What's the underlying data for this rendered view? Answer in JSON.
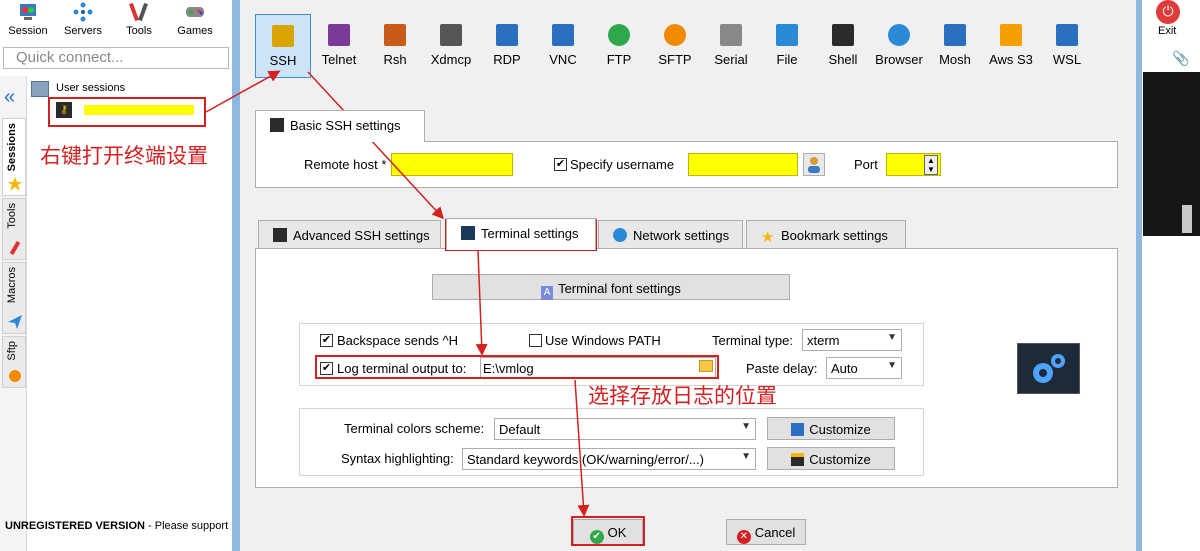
{
  "toolbar": {
    "session": "Session",
    "servers": "Servers",
    "tools": "Tools",
    "games": "Games",
    "exit": "Exit"
  },
  "quick_connect": {
    "placeholder": "Quick connect..."
  },
  "side_tabs": [
    "Sessions",
    "Tools",
    "Macros",
    "Sftp"
  ],
  "tree": {
    "root": "User sessions"
  },
  "status_bar": {
    "version": "UNREGISTERED VERSION",
    "message": "  -  Please support M"
  },
  "session_types": [
    {
      "label": "SSH",
      "icon": "key-icon"
    },
    {
      "label": "Telnet",
      "icon": "telnet-icon"
    },
    {
      "label": "Rsh",
      "icon": "rsh-icon"
    },
    {
      "label": "Xdmcp",
      "icon": "xdmcp-icon"
    },
    {
      "label": "RDP",
      "icon": "rdp-icon"
    },
    {
      "label": "VNC",
      "icon": "vnc-icon"
    },
    {
      "label": "FTP",
      "icon": "ftp-icon"
    },
    {
      "label": "SFTP",
      "icon": "sftp-icon"
    },
    {
      "label": "Serial",
      "icon": "serial-icon"
    },
    {
      "label": "File",
      "icon": "file-icon"
    },
    {
      "label": "Shell",
      "icon": "shell-icon"
    },
    {
      "label": "Browser",
      "icon": "globe-icon"
    },
    {
      "label": "Mosh",
      "icon": "mosh-icon"
    },
    {
      "label": "Aws S3",
      "icon": "aws-icon"
    },
    {
      "label": "WSL",
      "icon": "windows-icon"
    }
  ],
  "basic": {
    "tab": "Basic SSH settings",
    "remote_host_label": "Remote host *",
    "specify_username_label": "Specify username",
    "specify_username_checked": true,
    "port_label": "Port"
  },
  "lower_tabs": {
    "advanced": "Advanced SSH settings",
    "terminal": "Terminal settings",
    "network": "Network settings",
    "bookmark": "Bookmark settings"
  },
  "terminal": {
    "font_button": "Terminal font settings",
    "backspace_label": "Backspace sends ^H",
    "backspace_checked": true,
    "windows_path_label": "Use Windows PATH",
    "windows_path_checked": false,
    "terminal_type_label": "Terminal type:",
    "terminal_type_value": "xterm",
    "log_label": "Log terminal output to:",
    "log_checked": true,
    "log_path": "E:\\vmlog",
    "paste_delay_label": "Paste delay:",
    "paste_delay_value": "Auto",
    "colors_label": "Terminal colors scheme:",
    "colors_value": "Default",
    "customize_label": "Customize",
    "syntax_label": "Syntax highlighting:",
    "syntax_value": "Standard keywords (OK/warning/error/...)",
    "customize2_label": "Customize"
  },
  "buttons": {
    "ok": "OK",
    "cancel": "Cancel"
  },
  "annotations": {
    "right_click": "右键打开终端设置",
    "log_location": "选择存放日志的位置"
  },
  "colors": {
    "highlight": "#ffff00",
    "annotation": "#d42020",
    "selected_tab": "#cce4f7"
  }
}
